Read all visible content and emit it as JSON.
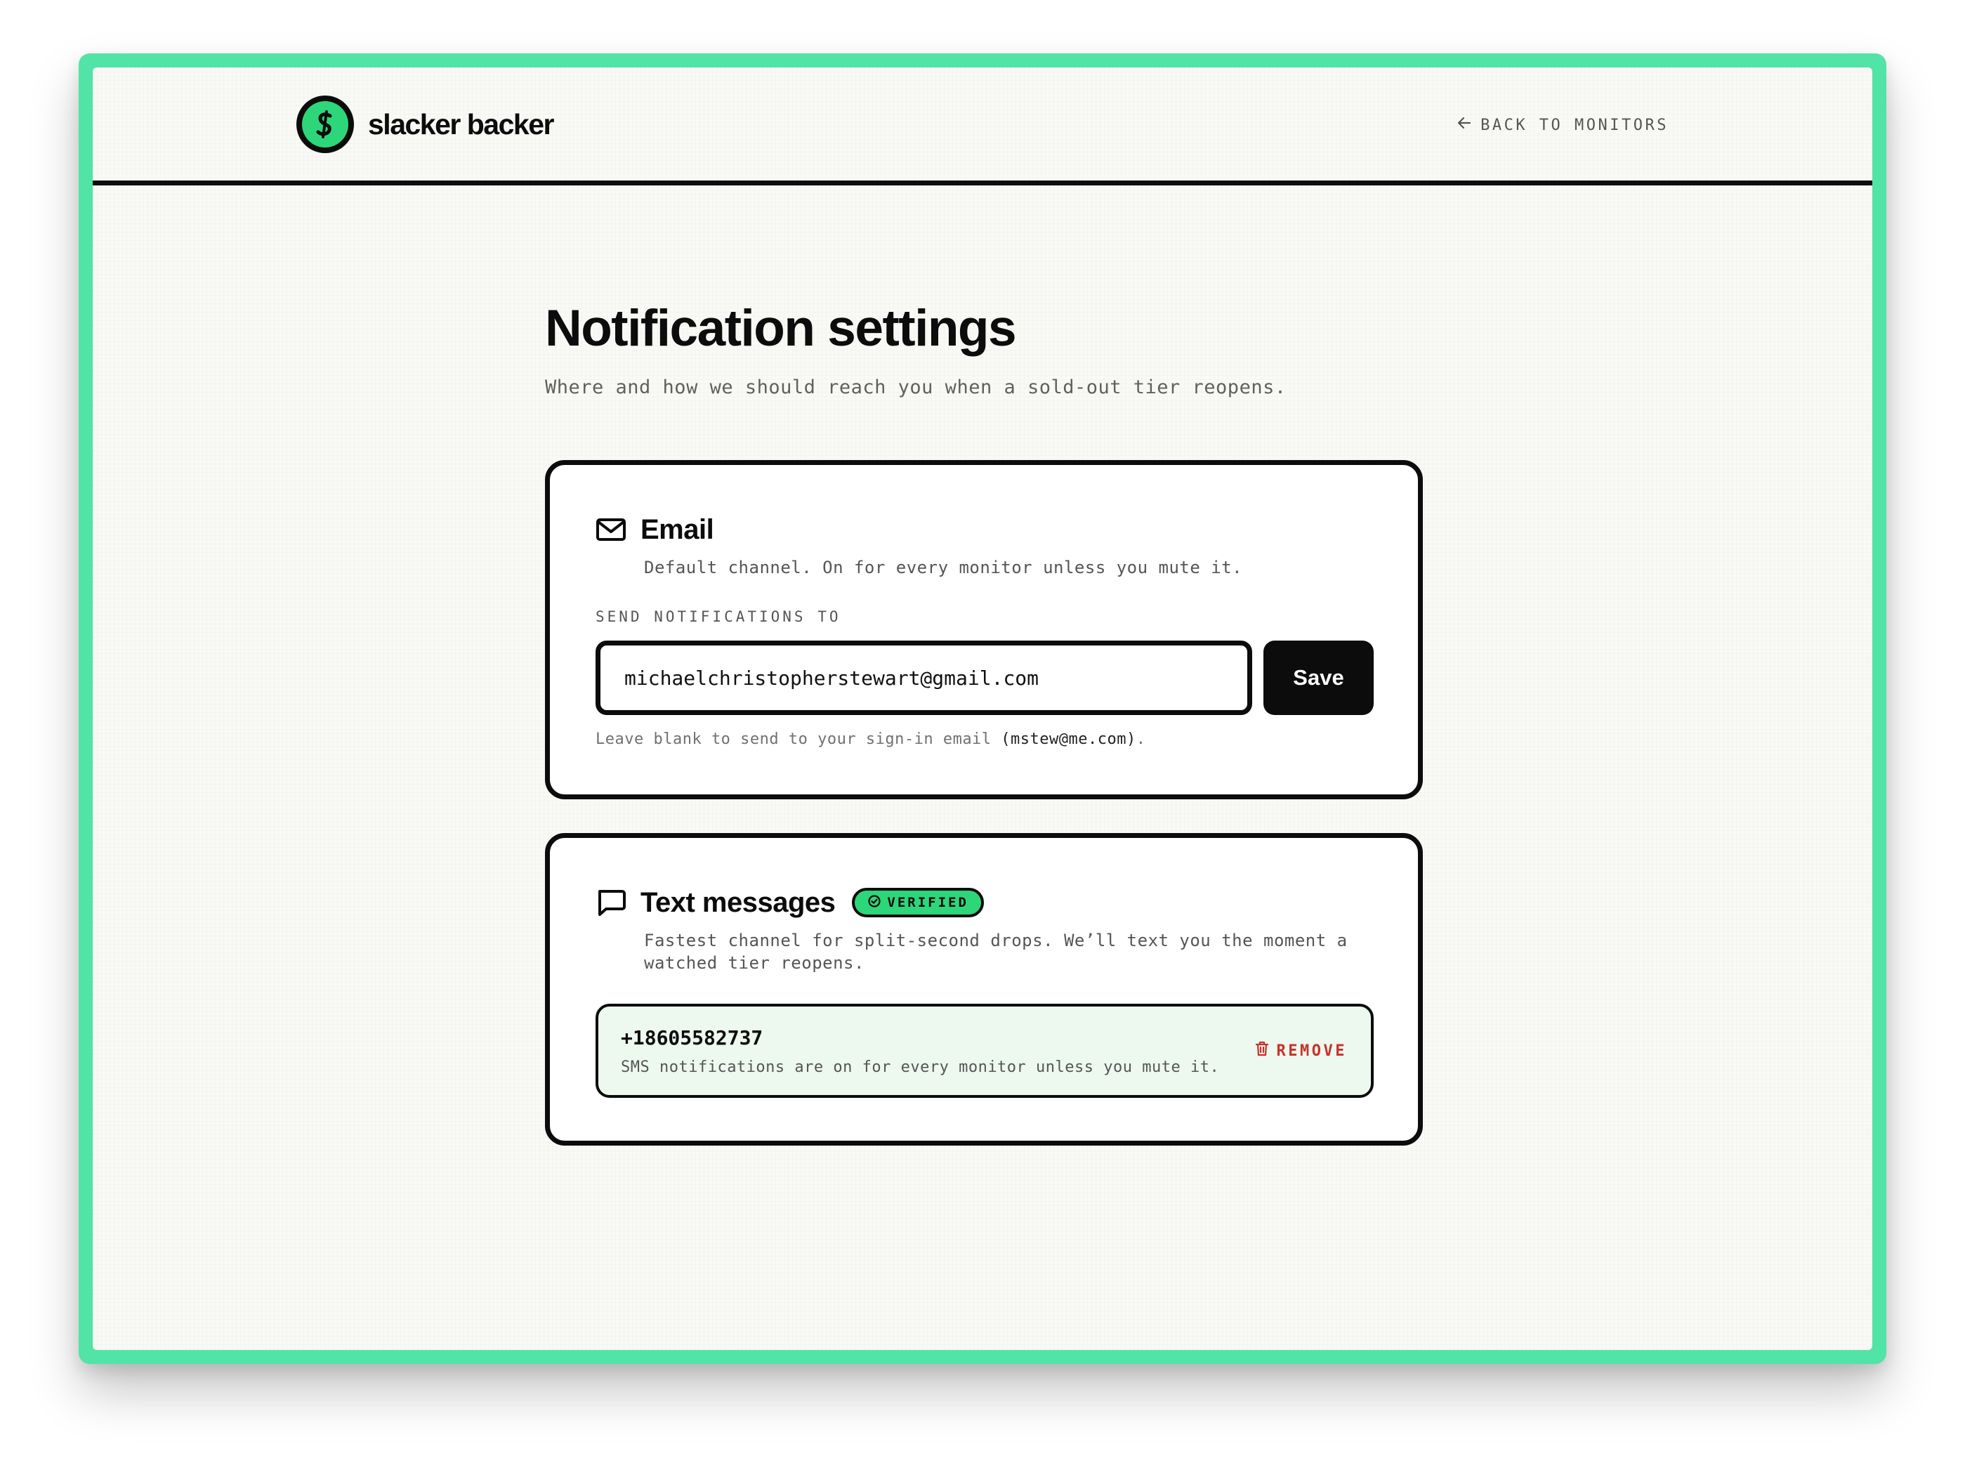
{
  "brand": {
    "name": "slacker backer",
    "accent_color": "#2ed67a",
    "frame_color": "#52e3a6"
  },
  "nav": {
    "back_label": "BACK TO MONITORS",
    "back_icon": "arrow-left-icon"
  },
  "page": {
    "title": "Notification settings",
    "subtitle": "Where and how we should reach you when a sold-out tier reopens."
  },
  "email_card": {
    "icon": "mail-icon",
    "title": "Email",
    "description": "Default channel. On for every monitor unless you mute it.",
    "field_label": "SEND NOTIFICATIONS TO",
    "input_value": "michaelchristopherstewart@gmail.com",
    "save_label": "Save",
    "helper_prefix": "Leave blank to send to your sign-in email ",
    "helper_email": "(mstew@me.com)",
    "helper_suffix": "."
  },
  "sms_card": {
    "icon": "message-icon",
    "title": "Text messages",
    "badge": "VERIFIED",
    "badge_icon": "check-circle-icon",
    "description": "Fastest channel for split-second drops. We’ll text you the moment a watched tier reopens.",
    "phone_number": "+18605582737",
    "phone_desc": "SMS notifications are on for every monitor unless you mute it.",
    "remove_label": "REMOVE",
    "remove_icon": "trash-icon",
    "remove_color": "#c9302c"
  }
}
